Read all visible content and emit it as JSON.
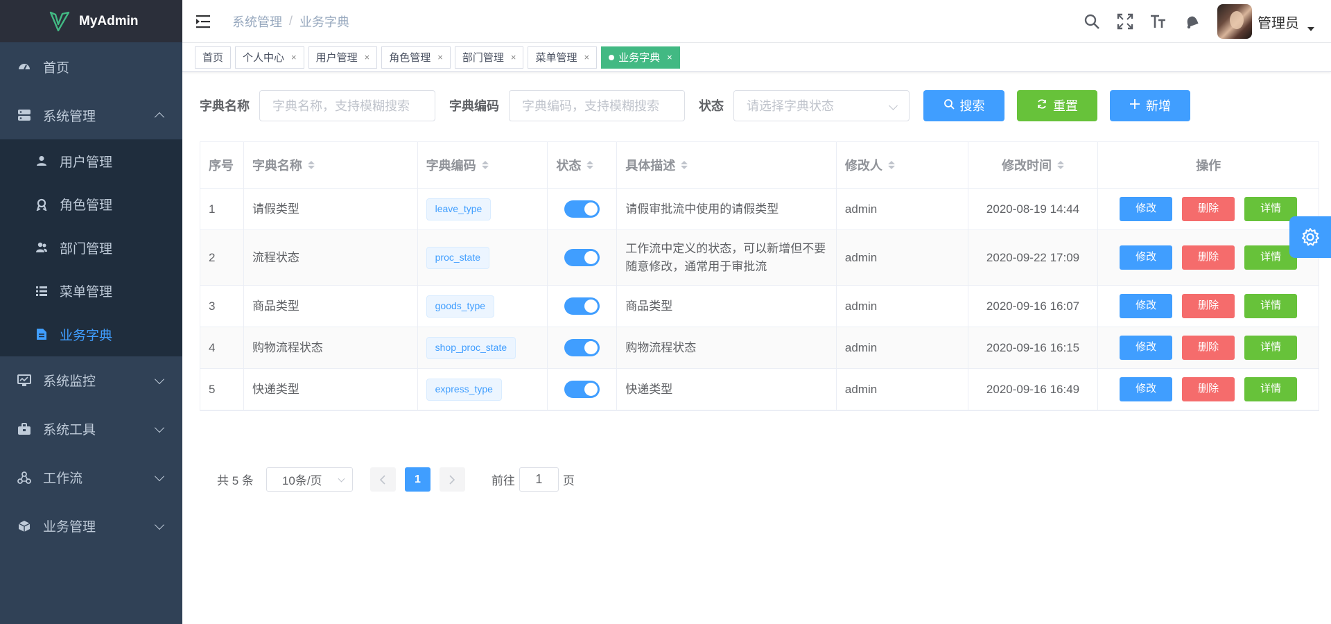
{
  "app": {
    "title": "MyAdmin"
  },
  "sidebar": {
    "items": [
      {
        "label": "首页",
        "icon": "dashboard-icon"
      },
      {
        "label": "系统管理",
        "icon": "server-icon",
        "expanded": true,
        "children": [
          {
            "label": "用户管理",
            "icon": "user-icon"
          },
          {
            "label": "角色管理",
            "icon": "badge-icon"
          },
          {
            "label": "部门管理",
            "icon": "team-icon"
          },
          {
            "label": "菜单管理",
            "icon": "list-icon"
          },
          {
            "label": "业务字典",
            "icon": "document-icon",
            "active": true
          }
        ]
      },
      {
        "label": "系统监控",
        "icon": "monitor-icon"
      },
      {
        "label": "系统工具",
        "icon": "briefcase-icon"
      },
      {
        "label": "工作流",
        "icon": "workflow-icon"
      },
      {
        "label": "业务管理",
        "icon": "cube-icon"
      }
    ]
  },
  "header": {
    "breadcrumb": [
      "系统管理",
      "业务字典"
    ],
    "breadcrumb_sep": "/",
    "username": "管理员"
  },
  "tags": [
    {
      "label": "首页",
      "closable": false
    },
    {
      "label": "个人中心",
      "closable": true
    },
    {
      "label": "用户管理",
      "closable": true
    },
    {
      "label": "角色管理",
      "closable": true
    },
    {
      "label": "部门管理",
      "closable": true
    },
    {
      "label": "菜单管理",
      "closable": true
    },
    {
      "label": "业务字典",
      "closable": true,
      "active": true
    }
  ],
  "tag_close": "×",
  "search": {
    "name_label": "字典名称",
    "name_placeholder": "字典名称，支持模糊搜索",
    "code_label": "字典编码",
    "code_placeholder": "字典编码，支持模糊搜索",
    "status_label": "状态",
    "status_placeholder": "请选择字典状态",
    "search_btn": "搜索",
    "reset_btn": "重置",
    "add_btn": "新增"
  },
  "table": {
    "headers": [
      "序号",
      "字典名称",
      "字典编码",
      "状态",
      "具体描述",
      "修改人",
      "修改时间",
      "操作"
    ],
    "rows": [
      {
        "index": "1",
        "name": "请假类型",
        "code": "leave_type",
        "enabled": true,
        "desc": "请假审批流中使用的请假类型",
        "modifier": "admin",
        "time": "2020-08-19 14:44"
      },
      {
        "index": "2",
        "name": "流程状态",
        "code": "proc_state",
        "enabled": true,
        "desc": "工作流中定义的状态，可以新增但不要随意修改，通常用于审批流",
        "modifier": "admin",
        "time": "2020-09-22 17:09"
      },
      {
        "index": "3",
        "name": "商品类型",
        "code": "goods_type",
        "enabled": true,
        "desc": "商品类型",
        "modifier": "admin",
        "time": "2020-09-16 16:07"
      },
      {
        "index": "4",
        "name": "购物流程状态",
        "code": "shop_proc_state",
        "enabled": true,
        "desc": "购物流程状态",
        "modifier": "admin",
        "time": "2020-09-16 16:15"
      },
      {
        "index": "5",
        "name": "快递类型",
        "code": "express_type",
        "enabled": true,
        "desc": "快递类型",
        "modifier": "admin",
        "time": "2020-09-16 16:49"
      }
    ],
    "actions": {
      "edit": "修改",
      "delete": "删除",
      "detail": "详情"
    }
  },
  "pagination": {
    "total_text": "共 5 条",
    "page_size": "10条/页",
    "current_page": "1",
    "goto_prefix": "前往",
    "goto_value": "1",
    "goto_suffix": "页"
  },
  "colors": {
    "accent": "#409eff",
    "success": "#67c23a",
    "danger": "#f56c6c",
    "sidebar_bg": "#304156",
    "tag_active": "#42b983"
  }
}
